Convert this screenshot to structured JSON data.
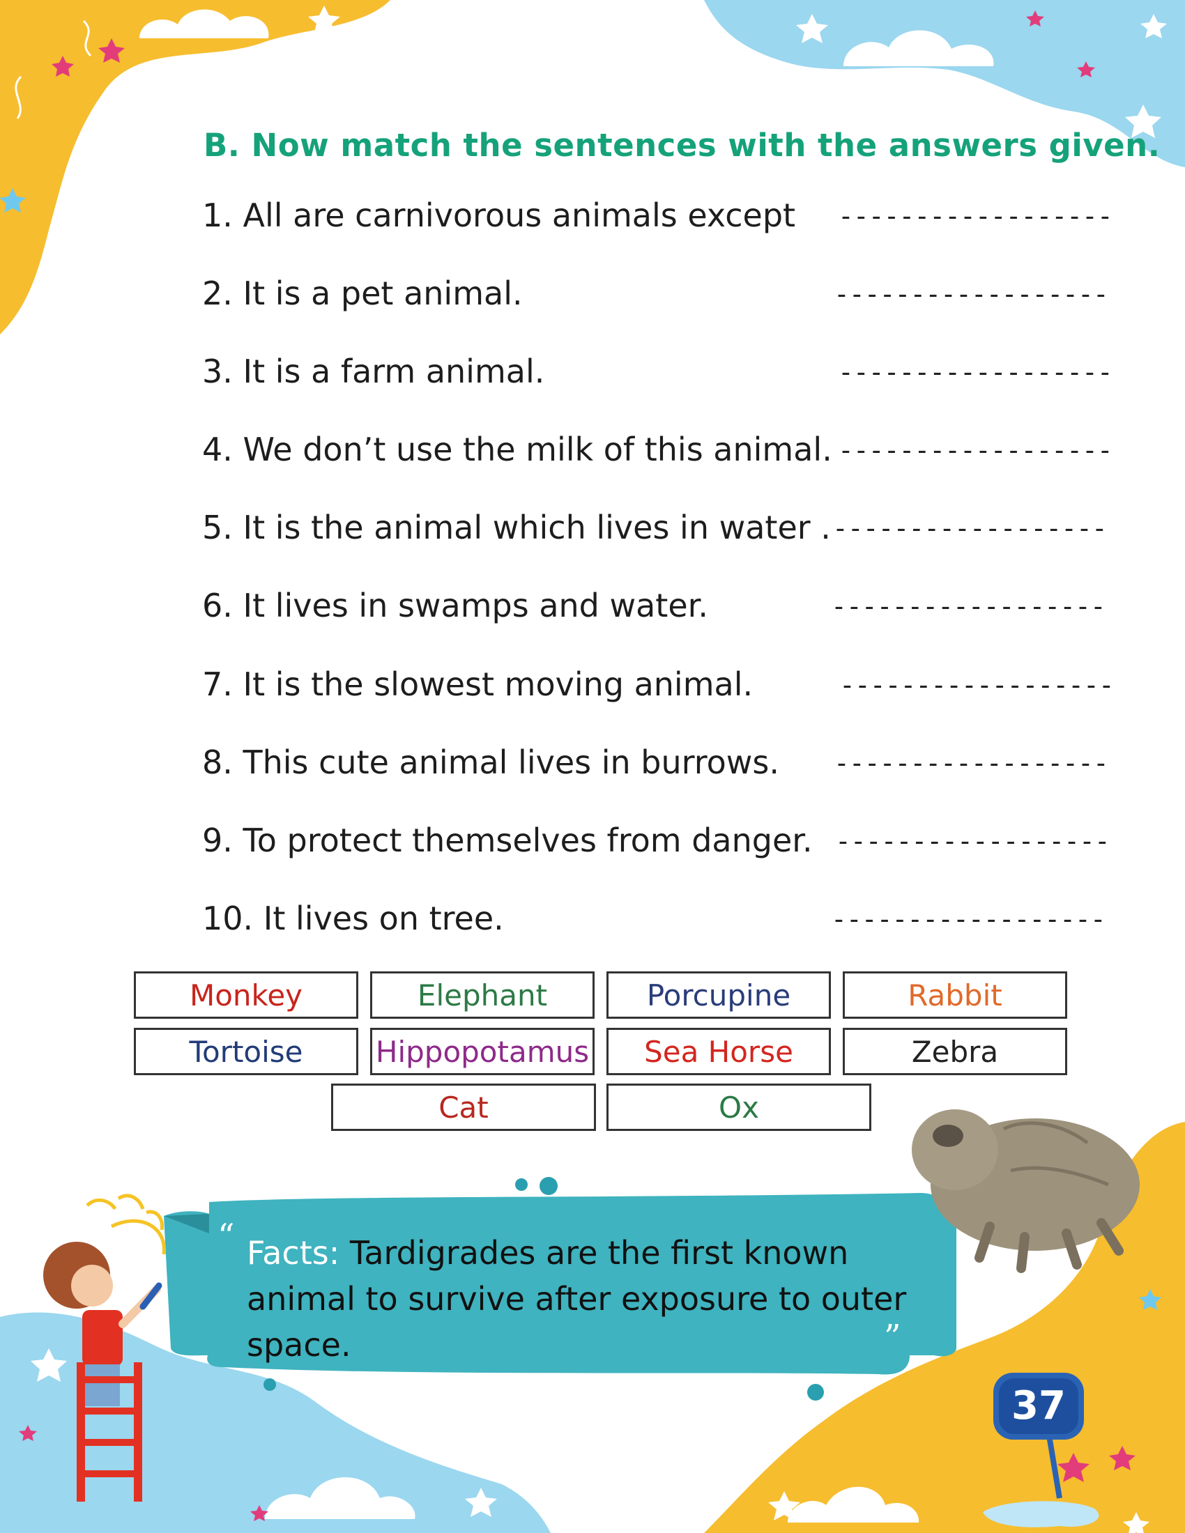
{
  "section": {
    "title": "B. Now match the sentences with the answers given."
  },
  "questions": [
    {
      "text": "1. All are carnivorous animals except",
      "blank": "------------------"
    },
    {
      "text": "2. It is a pet animal.",
      "blank": "------------------"
    },
    {
      "text": "3. It is a farm animal.",
      "blank": "------------------"
    },
    {
      "text": "4. We don’t use the milk of this animal.",
      "blank": "------------------"
    },
    {
      "text": "5. It is the animal which lives in water .",
      "blank": "------------------"
    },
    {
      "text": "6. It lives in swamps and water.",
      "blank": "------------------"
    },
    {
      "text": "7. It is the slowest moving animal.",
      "blank": "------------------"
    },
    {
      "text": "8. This cute animal lives in burrows.",
      "blank": "------------------"
    },
    {
      "text": "9. To protect themselves from danger.",
      "blank": "------------------"
    },
    {
      "text": "10. It lives on tree.",
      "blank": "------------------"
    }
  ],
  "word_bank": [
    {
      "label": "Monkey",
      "color": "#c7251c"
    },
    {
      "label": "Elephant",
      "color": "#2c7a45"
    },
    {
      "label": "Porcupine",
      "color": "#2a3d7a"
    },
    {
      "label": "Rabbit",
      "color": "#e06a2a"
    },
    {
      "label": "Tortoise",
      "color": "#223c78"
    },
    {
      "label": "Hippopotamus",
      "color": "#8e2a8a"
    },
    {
      "label": "Sea Horse",
      "color": "#d3261f"
    },
    {
      "label": "Zebra",
      "color": "#222222"
    },
    {
      "label": "Cat",
      "color": "#b8281f"
    },
    {
      "label": "Ox",
      "color": "#2a7a45"
    }
  ],
  "fact": {
    "label": "Facts:",
    "text": " Tardigrades are the first known animal to survive after exposure to outer space."
  },
  "page": {
    "number": "37"
  },
  "colors": {
    "title_green": "#15a27a",
    "banner_teal": "#3fb3bf",
    "corner_yellow": "#f6bd2f",
    "corner_blue": "#9bd7ef"
  }
}
